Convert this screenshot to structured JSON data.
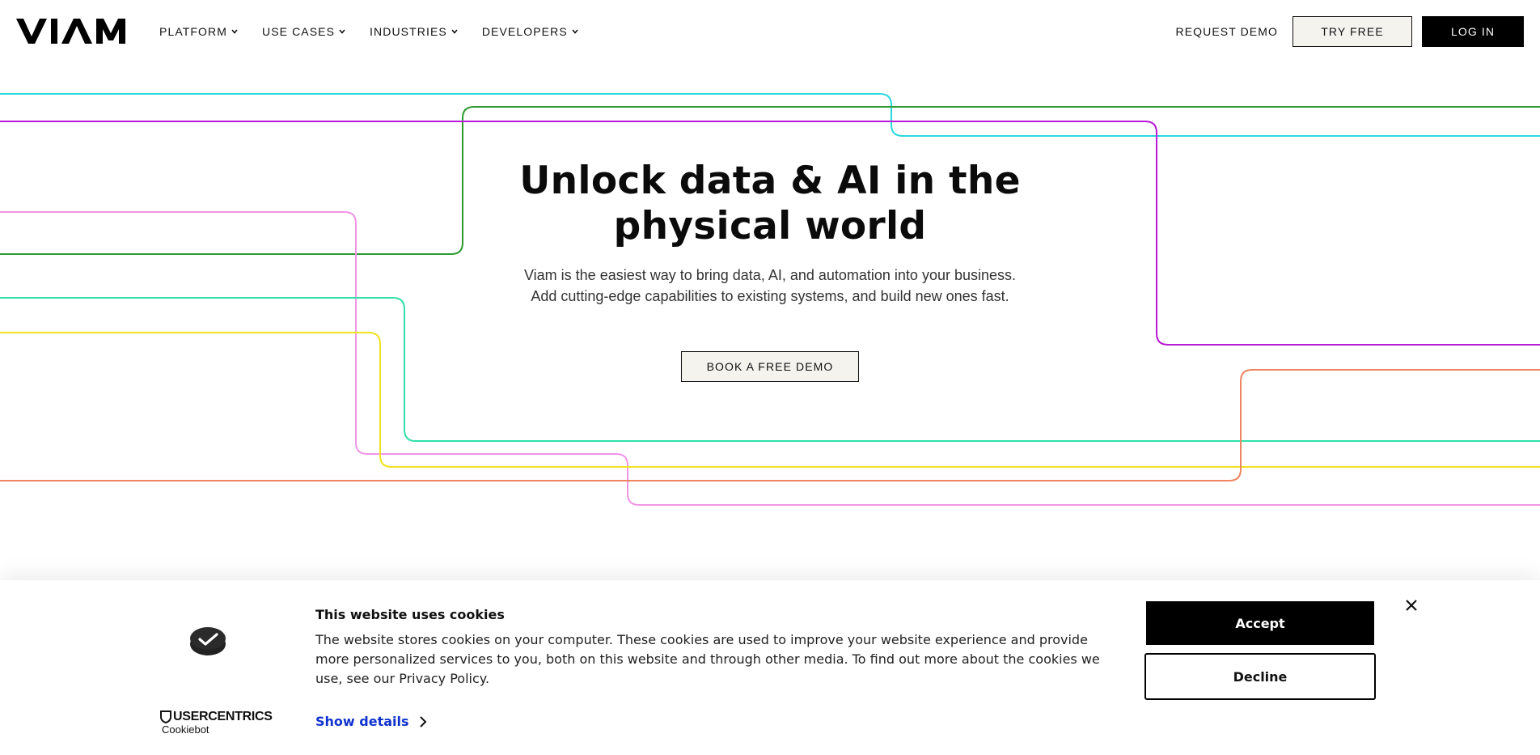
{
  "brand": {
    "logo_text": "VIAM"
  },
  "nav": {
    "menu": [
      {
        "label": "PLATFORM"
      },
      {
        "label": "USE CASES"
      },
      {
        "label": "INDUSTRIES"
      },
      {
        "label": "DEVELOPERS"
      }
    ],
    "request_demo": "REQUEST DEMO",
    "try_free": "TRY FREE",
    "log_in": "LOG IN"
  },
  "hero": {
    "title_line1": "Unlock data & AI in the",
    "title_line2": "physical world",
    "subtitle": "Viam is the easiest way to bring data, AI, and automation into your business. Add cutting-edge capabilities to existing systems, and build new ones fast.",
    "cta": "BOOK A FREE DEMO"
  },
  "decor_line_colors": {
    "cyan": "#27d9dc",
    "green": "#2c9a2e",
    "purple": "#b81ad6",
    "pink": "#f095e6",
    "teal": "#2fe0a8",
    "yellow": "#f0e31f",
    "orange": "#ef8561"
  },
  "cookie_banner": {
    "title": "This website uses cookies",
    "body": "The website stores cookies on your computer. These cookies are used to improve your website experience and provide more personalized services to you, both on this website and through other media. To find out more about the cookies we use, see our Privacy Policy.",
    "show_details": "Show details",
    "accept": "Accept",
    "decline": "Decline",
    "provider_brand": "USERCENTRICS",
    "provider_sub": "Cookiebot"
  }
}
